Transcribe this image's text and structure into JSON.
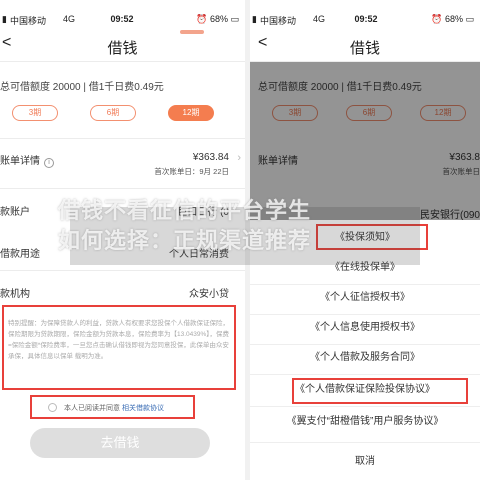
{
  "left": {
    "status": {
      "carrier": "中国移动",
      "network": "4G",
      "time": "09:52",
      "battery": "68%"
    },
    "nav": {
      "back": "<",
      "title": "借钱"
    },
    "quota_line": "总可借额度 20000 | 借1千日费0.49元",
    "tabs": [
      "3期",
      "6期",
      "12期"
    ],
    "selected_tab": "12期",
    "bill": {
      "label": "账单详情",
      "amount": "¥363.84",
      "first_due": "首次账单日：9月 22日"
    },
    "account": {
      "label": "款账户",
      "value": "巨口口行 (0"
    },
    "purpose": {
      "label": "借款用途",
      "value": "个人日常消费"
    },
    "institution": {
      "label": "款机构",
      "value": "众安小贷"
    },
    "notice_text": "特别提醒：为保障贷款人的利益，贷款人有权要求您投保个人借款保证保险，保险期限为贷款期限，保险金额为贷款本息，保险费率为【13.0439%】，保费=保险金额*保险费率，一旦您点击确认借钱即视为您同意投保，此保单由众安承保，具体信息以保单 载明为准。",
    "agree_text": "本人已阅读并同意",
    "agree_link": "相关借款协议",
    "submit_label": "去借钱"
  },
  "right": {
    "status": {
      "carrier": "中国移动",
      "network": "4G",
      "time": "09:52",
      "battery": "68%"
    },
    "nav": {
      "back": "<",
      "title": "借钱"
    },
    "quota_line": "总可借额度 20000 | 借1千日费0.49元",
    "tabs": [
      "3期",
      "6期",
      "12期"
    ],
    "bill": {
      "label": "账单详情",
      "amount": "¥363.8",
      "first_due": "首次账单日"
    },
    "account_value": "民安银行(090",
    "sheet_items": [
      "《投保须知》",
      "《在线投保单》",
      "《个人征信授权书》",
      "《个人信息使用授权书》",
      "《个人借款及服务合同》",
      "《个人借款保证保险投保协议》",
      "《翼支付“甜橙借钱”用户服务协议》",
      "取消"
    ]
  },
  "watermark": {
    "line1": "借钱不看征信的平台学生",
    "line2": "如何选择：正规渠道推荐"
  },
  "colors": {
    "accent": "#f47d4f",
    "highlight_border": "#e8403a",
    "link": "#3d6fb6"
  }
}
